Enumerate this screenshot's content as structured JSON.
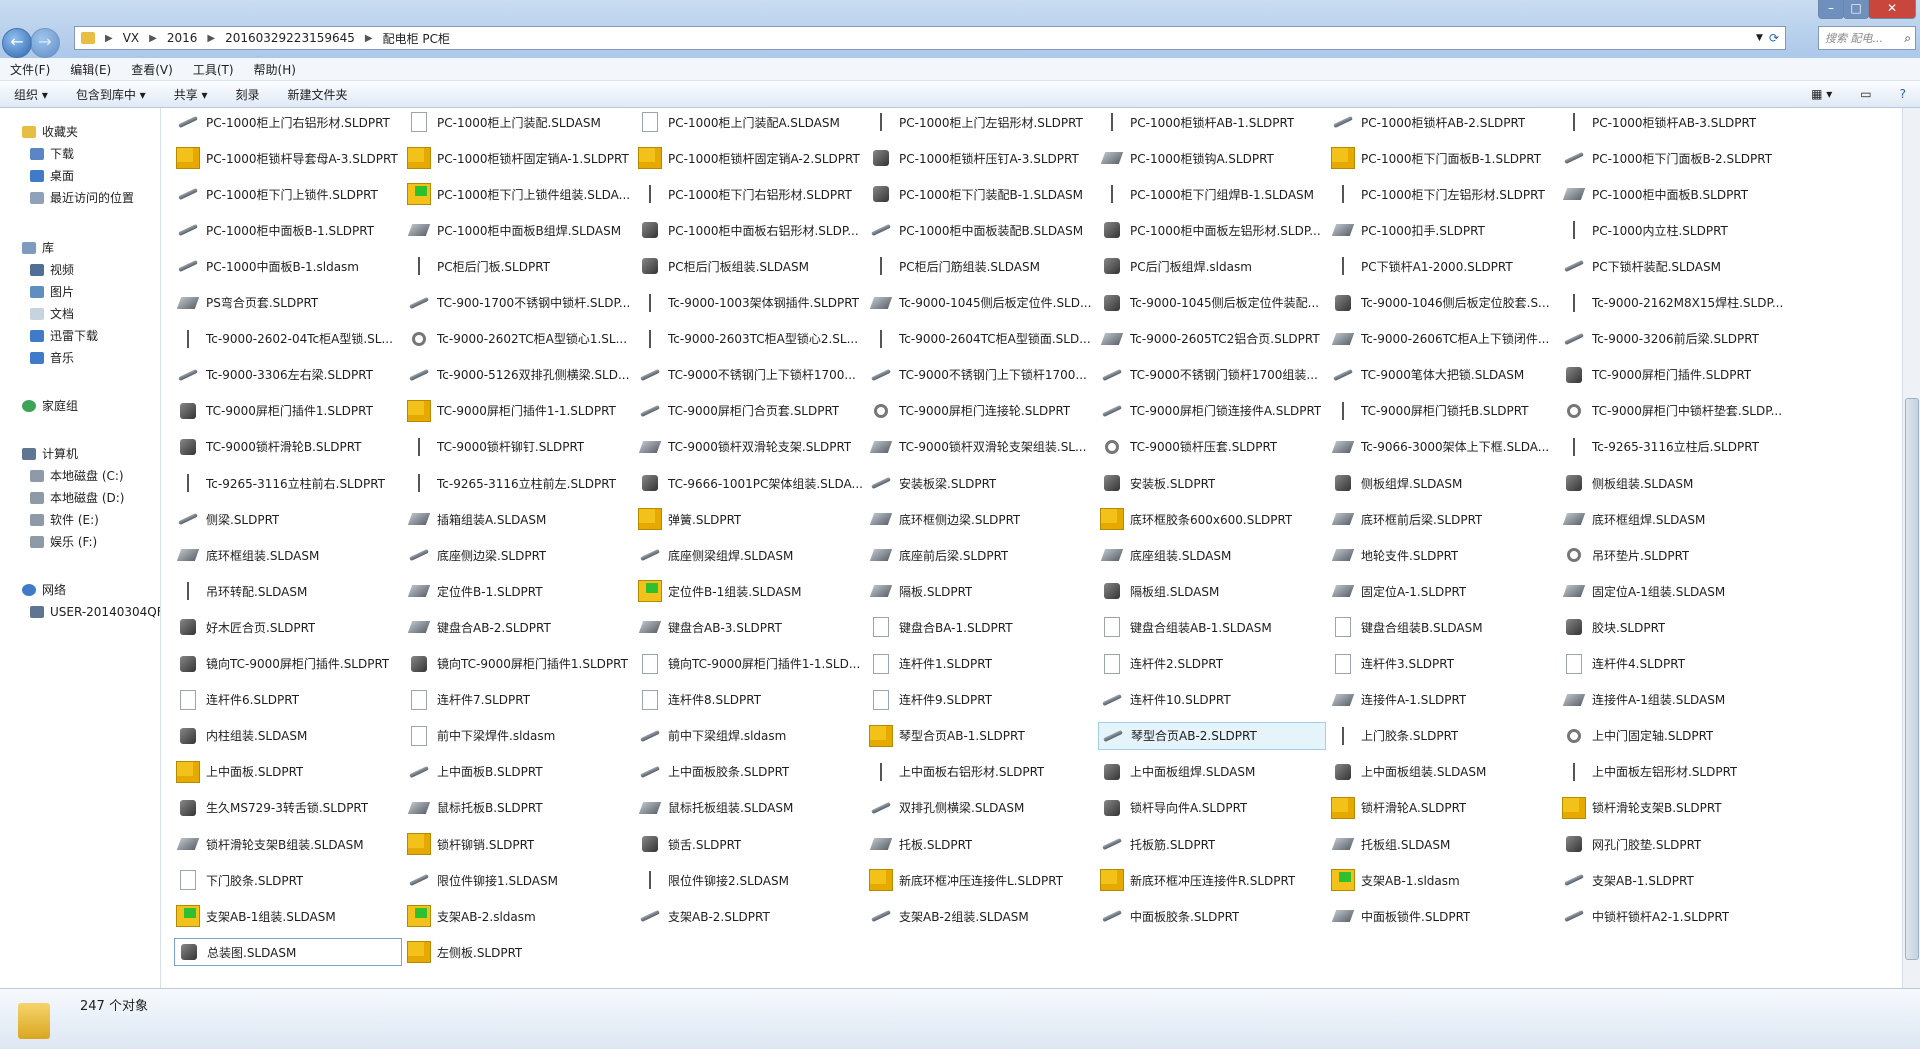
{
  "window": {
    "breadcrumb": [
      "VX",
      "2016",
      "20160329223159645",
      "配电柜 PC柜"
    ],
    "search_placeholder": "搜索 配电...",
    "controls": [
      "–",
      "□",
      "✕"
    ]
  },
  "menu": [
    "文件(F)",
    "编辑(E)",
    "查看(V)",
    "工具(T)",
    "帮助(H)"
  ],
  "toolbar": [
    "组织 ▾",
    "包含到库中 ▾",
    "共享 ▾",
    "刻录",
    "新建文件夹"
  ],
  "sidebar": {
    "favorites": "收藏夹",
    "favorites_items": [
      "下载",
      "桌面",
      "最近访问的位置"
    ],
    "library": "库",
    "library_items": [
      "视频",
      "图片",
      "文档",
      "迅雷下载",
      "音乐"
    ],
    "homegroup": "家庭组",
    "computer": "计算机",
    "drives": [
      "本地磁盘 (C:)",
      "本地磁盘 (D:)",
      "软件 (E:)",
      "娱乐 (F:)"
    ],
    "network": "网络",
    "network_items": [
      "USER-20140304QF"
    ]
  },
  "files": [
    [
      "PC-1000柜上门右铝形材.SLDPRT",
      "PC-1000柜上门装配.SLDASM",
      "PC-1000柜上门装配A.SLDASM",
      "PC-1000柜上门左铝形材.SLDPRT",
      "PC-1000柜锁杆AB-1.SLDPRT",
      "PC-1000柜锁杆AB-2.SLDPRT",
      "PC-1000柜锁杆AB-3.SLDPRT"
    ],
    [
      "PC-1000柜锁杆导套母A-3.SLDPRT",
      "PC-1000柜锁杆固定销A-1.SLDPRT",
      "PC-1000柜锁杆固定销A-2.SLDPRT",
      "PC-1000柜锁杆压钉A-3.SLDPRT",
      "PC-1000柜锁钩A.SLDPRT",
      "PC-1000柜下门面板B-1.SLDPRT",
      "PC-1000柜下门面板B-2.SLDPRT"
    ],
    [
      "PC-1000柜下门上锁件.SLDPRT",
      "PC-1000柜下门上锁件组装.SLDA...",
      "PC-1000柜下门右铝形材.SLDPRT",
      "PC-1000柜下门装配B-1.SLDASM",
      "PC-1000柜下门组焊B-1.SLDASM",
      "PC-1000柜下门左铝形材.SLDPRT",
      "PC-1000柜中面板B.SLDPRT"
    ],
    [
      "PC-1000柜中面板B-1.SLDPRT",
      "PC-1000柜中面板B组焊.SLDASM",
      "PC-1000柜中面板右铝形材.SLDP...",
      "PC-1000柜中面板装配B.SLDASM",
      "PC-1000柜中面板左铝形材.SLDP...",
      "PC-1000扣手.SLDPRT",
      "PC-1000内立柱.SLDPRT"
    ],
    [
      "PC-1000中面板B-1.sldasm",
      "PC柜后门板.SLDPRT",
      "PC柜后门板组装.SLDASM",
      "PC柜后门筋组装.SLDASM",
      "PC后门板组焊.sldasm",
      "PC下锁杆A1-2000.SLDPRT",
      "PC下锁杆装配.SLDASM"
    ],
    [
      "PS弯合页套.SLDPRT",
      "TC-900-1700不锈钢中锁杆.SLDP...",
      "Tc-9000-1003架体钢插件.SLDPRT",
      "Tc-9000-1045侧后板定位件.SLD...",
      "Tc-9000-1045侧后板定位件装配...",
      "Tc-9000-1046侧后板定位胶套.S...",
      "Tc-9000-2162M8X15焊柱.SLDP..."
    ],
    [
      "Tc-9000-2602-04Tc柜A型锁.SL...",
      "Tc-9000-2602TC柜A型锁心1.SL...",
      "Tc-9000-2603TC柜A型锁心2.SL...",
      "Tc-9000-2604TC柜A型锁面.SLD...",
      "Tc-9000-2605TC2铝合页.SLDPRT",
      "Tc-9000-2606TC柜A上下锁闭件...",
      "Tc-9000-3206前后梁.SLDPRT"
    ],
    [
      "Tc-9000-3306左右梁.SLDPRT",
      "Tc-9000-5126双排孔侧横梁.SLD...",
      "TC-9000不锈钢门上下锁杆1700...",
      "TC-9000不锈钢门上下锁杆1700...",
      "TC-9000不锈钢门锁杆1700组装...",
      "TC-9000笔体大把锁.SLDASM",
      "TC-9000屏柜门插件.SLDPRT"
    ],
    [
      "TC-9000屏柜门插件1.SLDPRT",
      "TC-9000屏柜门插件1-1.SLDPRT",
      "TC-9000屏柜门合页套.SLDPRT",
      "TC-9000屏柜门连接轮.SLDPRT",
      "TC-9000屏柜门锁连接件A.SLDPRT",
      "TC-9000屏柜门锁托B.SLDPRT",
      "TC-9000屏柜门中锁杆垫套.SLDP..."
    ],
    [
      "TC-9000锁杆滑轮B.SLDPRT",
      "TC-9000锁杆铆钉.SLDPRT",
      "TC-9000锁杆双滑轮支架.SLDPRT",
      "TC-9000锁杆双滑轮支架组装.SL...",
      "TC-9000锁杆压套.SLDPRT",
      "Tc-9066-3000架体上下框.SLDA...",
      "Tc-9265-3116立柱后.SLDPRT"
    ],
    [
      "Tc-9265-3116立柱前右.SLDPRT",
      "Tc-9265-3116立柱前左.SLDPRT",
      "TC-9666-1001PC架体组装.SLDA...",
      "安装板梁.SLDPRT",
      "安装板.SLDPRT",
      "侧板组焊.SLDASM",
      "侧板组装.SLDASM"
    ],
    [
      "侧梁.SLDPRT",
      "插箱组装A.SLDASM",
      "弹簧.SLDPRT",
      "底环框侧边梁.SLDPRT",
      "底环框胶条600x600.SLDPRT",
      "底环框前后梁.SLDPRT",
      "底环框组焊.SLDASM"
    ],
    [
      "底环框组装.SLDASM",
      "底座侧边梁.SLDPRT",
      "底座侧梁组焊.SLDASM",
      "底座前后梁.SLDPRT",
      "底座组装.SLDASM",
      "地轮支件.SLDPRT",
      "吊环垫片.SLDPRT"
    ],
    [
      "吊环转配.SLDASM",
      "定位件B-1.SLDPRT",
      "定位件B-1组装.SLDASM",
      "隔板.SLDPRT",
      "隔板组.SLDASM",
      "固定位A-1.SLDPRT",
      "固定位A-1组装.SLDASM"
    ],
    [
      "好木匠合页.SLDPRT",
      "键盘合AB-2.SLDPRT",
      "键盘合AB-3.SLDPRT",
      "键盘合BA-1.SLDPRT",
      "键盘合组装AB-1.SLDASM",
      "键盘合组装B.SLDASM",
      "胶块.SLDPRT"
    ],
    [
      "镜向TC-9000屏柜门插件.SLDPRT",
      "镜向TC-9000屏柜门插件1.SLDPRT",
      "镜向TC-9000屏柜门插件1-1.SLD...",
      "连杆件1.SLDPRT",
      "连杆件2.SLDPRT",
      "连杆件3.SLDPRT",
      "连杆件4.SLDPRT"
    ],
    [
      "连杆件6.SLDPRT",
      "连杆件7.SLDPRT",
      "连杆件8.SLDPRT",
      "连杆件9.SLDPRT",
      "连杆件10.SLDPRT",
      "连接件A-1.SLDPRT",
      "连接件A-1组装.SLDASM"
    ],
    [
      "内柱组装.SLDASM",
      "前中下梁焊件.sldasm",
      "前中下梁组焊.sldasm",
      "琴型合页AB-1.SLDPRT",
      "琴型合页AB-2.SLDPRT",
      "上门胶条.SLDPRT",
      "上中门固定轴.SLDPRT"
    ],
    [
      "上中面板.SLDPRT",
      "上中面板B.SLDPRT",
      "上中面板胶条.SLDPRT",
      "上中面板右铝形材.SLDPRT",
      "上中面板组焊.SLDASM",
      "上中面板组装.SLDASM",
      "上中面板左铝形材.SLDPRT"
    ],
    [
      "生久MS729-3转舌锁.SLDPRT",
      "鼠标托板B.SLDPRT",
      "鼠标托板组装.SLDASM",
      "双排孔侧横梁.SLDASM",
      "锁杆导向件A.SLDPRT",
      "锁杆滑轮A.SLDPRT",
      "锁杆滑轮支架B.SLDPRT"
    ],
    [
      "锁杆滑轮支架B组装.SLDASM",
      "锁杆铆销.SLDPRT",
      "锁舌.SLDPRT",
      "托板.SLDPRT",
      "托板筋.SLDPRT",
      "托板组.SLDASM",
      "网孔门胶垫.SLDPRT"
    ],
    [
      "下门胶条.SLDPRT",
      "限位件铆接1.SLDASM",
      "限位件铆接2.SLDASM",
      "新底环框冲压连接件L.SLDPRT",
      "新底环框冲压连接件R.SLDPRT",
      "支架AB-1.sldasm",
      "支架AB-1.SLDPRT"
    ],
    [
      "支架AB-1组装.SLDASM",
      "支架AB-2.sldasm",
      "支架AB-2.SLDPRT",
      "支架AB-2组装.SLDASM",
      "中面板胶条.SLDPRT",
      "中面板锁件.SLDPRT",
      "中锁杆锁杆A2-1.SLDPRT"
    ],
    [
      "总装图.SLDASM",
      "左侧板.SLDPRT"
    ]
  ],
  "icons": [
    [
      "rod",
      "doc",
      "doc",
      "thin",
      "thin",
      "rod",
      "thin"
    ],
    [
      "asm",
      "asm",
      "asm",
      "blk",
      "pl",
      "asm",
      "rod"
    ],
    [
      "rod",
      "grn",
      "thin",
      "blk",
      "thin",
      "thin",
      "pl"
    ],
    [
      "rod",
      "pl",
      "blk",
      "rod",
      "blk",
      "pl",
      "thin"
    ],
    [
      "rod",
      "thin",
      "blk",
      "thin",
      "blk",
      "thin",
      "rod"
    ],
    [
      "pl",
      "rod",
      "thin",
      "pl",
      "blk",
      "blk",
      "thin"
    ],
    [
      "thin",
      "ring",
      "thin",
      "thin",
      "pl",
      "pl",
      "rod"
    ],
    [
      "rod",
      "rod",
      "rod",
      "rod",
      "rod",
      "rod",
      "blk"
    ],
    [
      "blk",
      "asm",
      "rod",
      "ring",
      "rod",
      "thin",
      "ring"
    ],
    [
      "blk",
      "thin",
      "pl",
      "pl",
      "ring",
      "pl",
      "thin"
    ],
    [
      "thin",
      "thin",
      "blk",
      "rod",
      "blk",
      "blk",
      "blk"
    ],
    [
      "rod",
      "pl",
      "asm",
      "pl",
      "asm",
      "pl",
      "pl"
    ],
    [
      "pl",
      "rod",
      "rod",
      "pl",
      "pl",
      "pl",
      "ring"
    ],
    [
      "thin",
      "pl",
      "grn",
      "pl",
      "blk",
      "pl",
      "pl"
    ],
    [
      "blk",
      "pl",
      "pl",
      "doc",
      "doc",
      "doc",
      "blk"
    ],
    [
      "blk",
      "blk",
      "doc",
      "doc",
      "doc",
      "doc",
      "doc"
    ],
    [
      "doc",
      "doc",
      "doc",
      "doc",
      "rod",
      "pl",
      "pl"
    ],
    [
      "blk",
      "doc",
      "rod",
      "asm",
      "rod",
      "thin",
      "ring"
    ],
    [
      "asm",
      "rod",
      "rod",
      "thin",
      "blk",
      "blk",
      "thin"
    ],
    [
      "blk",
      "pl",
      "pl",
      "rod",
      "blk",
      "asm",
      "asm"
    ],
    [
      "pl",
      "asm",
      "blk",
      "pl",
      "rod",
      "pl",
      "blk"
    ],
    [
      "doc",
      "rod",
      "thin",
      "asm",
      "asm",
      "grn",
      "rod"
    ],
    [
      "grn",
      "grn",
      "rod",
      "rod",
      "rod",
      "pl",
      "rod"
    ],
    [
      "blk",
      "asm"
    ]
  ],
  "status": {
    "count": "247 个对象"
  }
}
